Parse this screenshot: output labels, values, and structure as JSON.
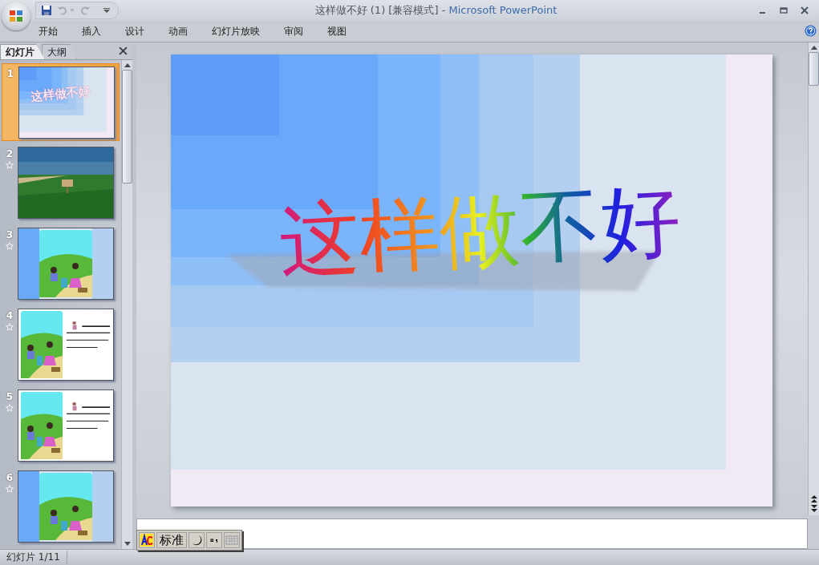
{
  "window": {
    "document": "这样做不好 (1) [兼容模式]",
    "separator": "-",
    "app": "Microsoft PowerPoint"
  },
  "ribbon_tabs": [
    {
      "label": "开始",
      "selected": false
    },
    {
      "label": "插入",
      "selected": false
    },
    {
      "label": "设计",
      "selected": false
    },
    {
      "label": "动画",
      "selected": false
    },
    {
      "label": "幻灯片放映",
      "selected": false
    },
    {
      "label": "审阅",
      "selected": false
    },
    {
      "label": "视图",
      "selected": false
    }
  ],
  "pane_tabs": [
    {
      "label": "幻灯片",
      "selected": true
    },
    {
      "label": "大纲",
      "selected": false
    }
  ],
  "slides": [
    {
      "number": "1",
      "selected": true,
      "animated": false,
      "kind": "title",
      "title": "这样做不好"
    },
    {
      "number": "2",
      "selected": false,
      "animated": true,
      "kind": "landscape"
    },
    {
      "number": "3",
      "selected": false,
      "animated": true,
      "kind": "framed-picture"
    },
    {
      "number": "4",
      "selected": false,
      "animated": true,
      "kind": "picture-text"
    },
    {
      "number": "5",
      "selected": false,
      "animated": true,
      "kind": "picture-text"
    },
    {
      "number": "6",
      "selected": false,
      "animated": true,
      "kind": "framed-picture"
    }
  ],
  "slide": {
    "title": "这样做不好"
  },
  "ime": {
    "mode": "标准"
  },
  "status_bar": {
    "slide_indicator": "幻灯片 1/11"
  }
}
